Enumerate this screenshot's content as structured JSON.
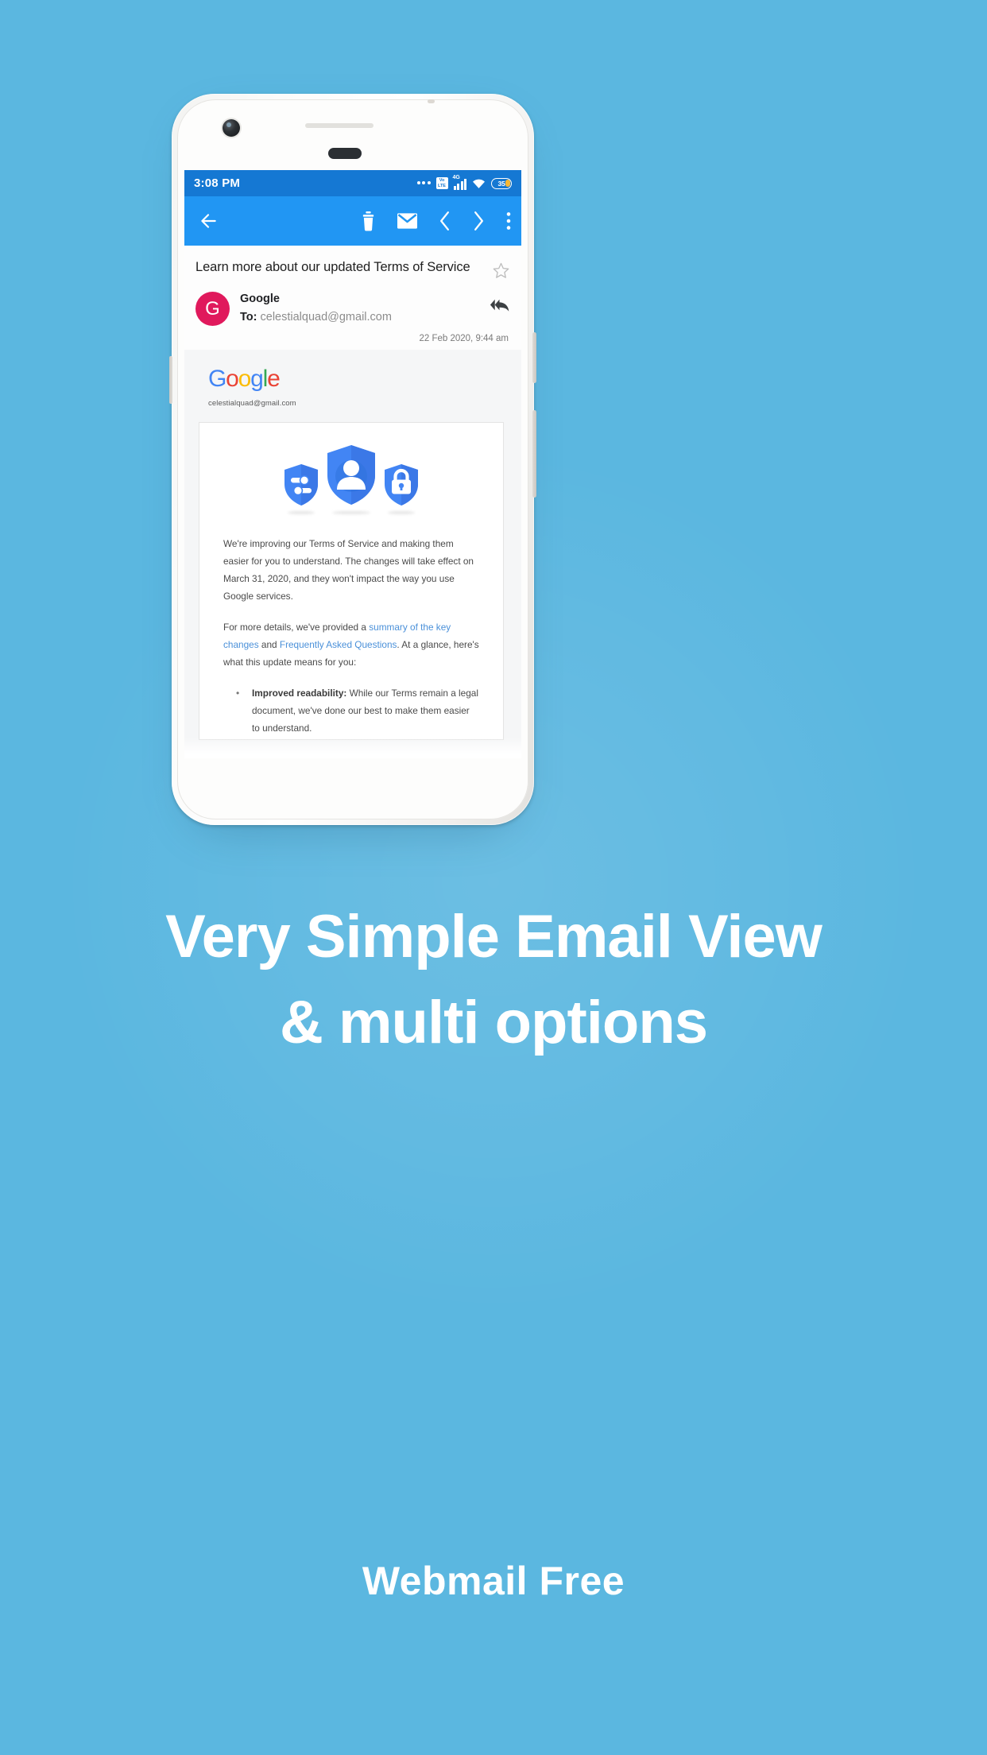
{
  "page": {
    "background_color": "#5bb7e0",
    "headline_line1": "Very Simple Email View",
    "headline_line2": "& multi options",
    "subline": "Webmail Free"
  },
  "status_bar": {
    "time": "3:08 PM",
    "network_label": "VoLTE",
    "network_type": "4G",
    "battery_percent": "35",
    "icons": [
      "more-dots",
      "volte-icon",
      "signal-bars-icon",
      "wifi-icon",
      "battery-icon"
    ]
  },
  "app_bar": {
    "background_color": "#2196f3",
    "back_label": "Back",
    "delete_label": "Delete",
    "mark_unread_label": "Mark as unread",
    "previous_label": "Previous",
    "next_label": "Next",
    "more_label": "More options"
  },
  "mail": {
    "subject": "Learn more about our updated Terms of Service",
    "star_state": "off",
    "avatar_letter": "G",
    "avatar_color": "#e0195c",
    "sender": "Google",
    "to_label": "To:",
    "to_address": "celestialquad@gmail.com",
    "date": "22 Feb 2020, 9:44 am",
    "reply_all_label": "Reply all"
  },
  "body": {
    "logo_text": "Google",
    "logo_letters": [
      {
        "ch": "G",
        "color": "#4285f4"
      },
      {
        "ch": "o",
        "color": "#ea4335"
      },
      {
        "ch": "o",
        "color": "#fbbc05"
      },
      {
        "ch": "g",
        "color": "#4285f4"
      },
      {
        "ch": "l",
        "color": "#34a853"
      },
      {
        "ch": "e",
        "color": "#ea4335"
      }
    ],
    "account_email": "celestialquad@gmail.com",
    "hero_icons": [
      "shield-settings-icon",
      "shield-person-icon",
      "shield-lock-icon"
    ],
    "paragraph1": "We're improving our Terms of Service and making them easier for you to understand. The changes will take effect on March 31, 2020, and they won't impact the way you use Google services.",
    "paragraph2_pre": "For more details, we've provided a ",
    "paragraph2_link1": "summary of the key changes",
    "paragraph2_mid": " and ",
    "paragraph2_link2": "Frequently Asked Questions",
    "paragraph2_post": ". At a glance, here's what this update means for you:",
    "bullet1_title": "Improved readability:",
    "bullet1_text": " While our Terms remain a legal document, we've done our best to make them easier to understand."
  }
}
